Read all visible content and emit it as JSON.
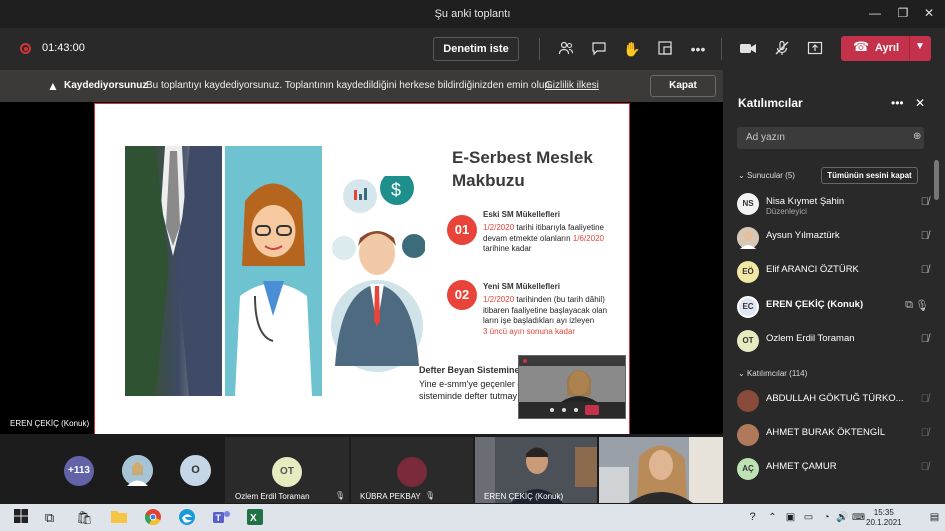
{
  "window": {
    "title": "Şu anki toplantı"
  },
  "toolbar": {
    "timer": "01:43:00",
    "review_button": "Denetim iste",
    "leave_label": "Ayrıl",
    "icons": [
      "people-icon",
      "chat-icon",
      "raise-hand-icon",
      "rooms-icon",
      "more-icon",
      "camera-icon",
      "mic-off-icon",
      "share-icon"
    ]
  },
  "banner": {
    "bold": "Kaydediyorsunuz",
    "message": "Bu toplantıyı kaydediyorsunuz. Toplantının kaydedildiğini herkese bildirdiğinizden emin olun.",
    "link": "Gizlilik ilkesi",
    "close": "Kapat"
  },
  "slide": {
    "title_line1": "E-Serbest Meslek",
    "title_line2": "Makbuzu",
    "item1_num": "01",
    "item1_head": "Eski SM Mükellefleri",
    "item1_a": "1/2/2020",
    "item1_b": " tarihi itibarıyla faaliyetine",
    "item1_c": "devam etmekte olanların ",
    "item1_d": "1/6/2020",
    "item1_e": "tarihine kadar",
    "item2_num": "02",
    "item2_head": "Yeni SM Mükellefleri",
    "item2_a": "1/2/2020",
    "item2_b": " tarihinden (bu tarih dâhil)",
    "item2_c": "itibaren faaliyetine başlayacak olan",
    "item2_d": "ların işe başladıkları ayı izleyen",
    "item2_e": "3 üncü ayın sonuna kadar",
    "bottom_head": "Defter Beyan Sistemine",
    "bottom_line1": "Yine e-smm'ye geçenler e",
    "bottom_line2": "sisteminde defter tutmay"
  },
  "presenter": {
    "name": "EREN ÇEKİÇ (Konuk)"
  },
  "gallery": {
    "overflow": "+113",
    "o_initial": "O",
    "ot_initials": "OT",
    "ot_name": "Ozlem Erdil Toraman",
    "kubra_name": "KÜBRA PEKBAY",
    "eren_name": "EREN ÇEKİÇ (Konuk)"
  },
  "panel": {
    "title": "Katılımcılar",
    "search_placeholder": "Ad yazın",
    "presenters_header": "Sunucular (5)",
    "mute_all": "Tümünün sesini kapat",
    "attendees_header": "Katılımcılar (114)",
    "presenters": [
      {
        "initials": "NS",
        "name": "Nisa Kıymet Şahin",
        "role": "Düzenleyici"
      },
      {
        "initials": "",
        "name": "Aysun Yılmaztürk",
        "role": ""
      },
      {
        "initials": "EÖ",
        "name": "Elif ARANCI ÖZTÜRK",
        "role": ""
      },
      {
        "initials": "EC",
        "name": "EREN ÇEKİÇ (Konuk)",
        "role": ""
      },
      {
        "initials": "OT",
        "name": "Ozlem Erdil Toraman",
        "role": ""
      }
    ],
    "attendees": [
      {
        "initials": "",
        "name": "ABDULLAH GÖKTUĞ TÜRKO..."
      },
      {
        "initials": "",
        "name": "AHMET BURAK ÖKTENGİL"
      },
      {
        "initials": "AÇ",
        "name": "AHMET ÇAMUR"
      }
    ]
  },
  "taskbar": {
    "time": "15:35",
    "date": "20.1.2021"
  }
}
